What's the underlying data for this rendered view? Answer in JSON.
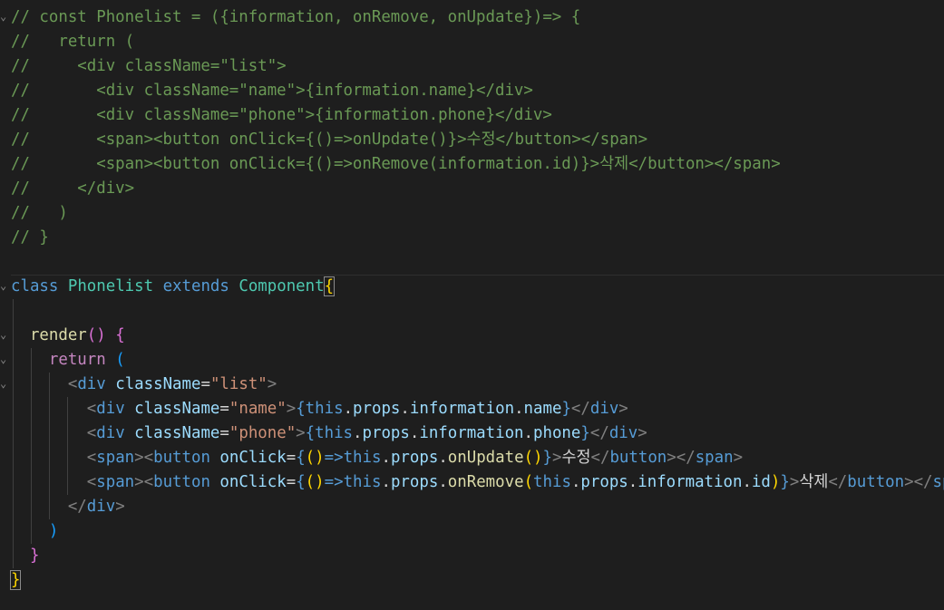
{
  "editor": {
    "comment_lines": [
      "// const Phonelist = ({information, onRemove, onUpdate})=> {",
      "//   return (",
      "//     <div className=\"list\">",
      "//       <div className=\"name\">{information.name}</div>",
      "//       <div className=\"phone\">{information.phone}</div>",
      "//       <span><button onClick={()=>onUpdate()}>수정</button></span>",
      "//       <span><button onClick={()=>onRemove(information.id)}>삭제</button></span>",
      "//     </div>",
      "//   )",
      "// }"
    ],
    "class_decl": {
      "keyword_class": "class",
      "class_name": "Phonelist",
      "keyword_extends": "extends",
      "base_class": "Component",
      "open_brace": "{"
    },
    "render_method": {
      "name": "render",
      "parens": "()",
      "open_brace": "{"
    },
    "return_stmt": {
      "keyword": "return",
      "open_paren": "("
    },
    "jsx": {
      "tag_div": "div",
      "tag_span": "span",
      "tag_button": "button",
      "attr_classname": "className",
      "attr_onclick": "onClick",
      "list_value": "\"list\"",
      "name_value": "\"name\"",
      "phone_value": "\"phone\"",
      "this_kw": "this",
      "props": "props",
      "information": "information",
      "name": "name",
      "phone": "phone",
      "id": "id",
      "on_update": "onUpdate",
      "on_remove": "onRemove",
      "update_label": "수정",
      "remove_label": "삭제"
    },
    "closers": {
      "return_close": ")",
      "render_close": "}",
      "class_close": "}"
    },
    "fold_marker": "⌄"
  }
}
